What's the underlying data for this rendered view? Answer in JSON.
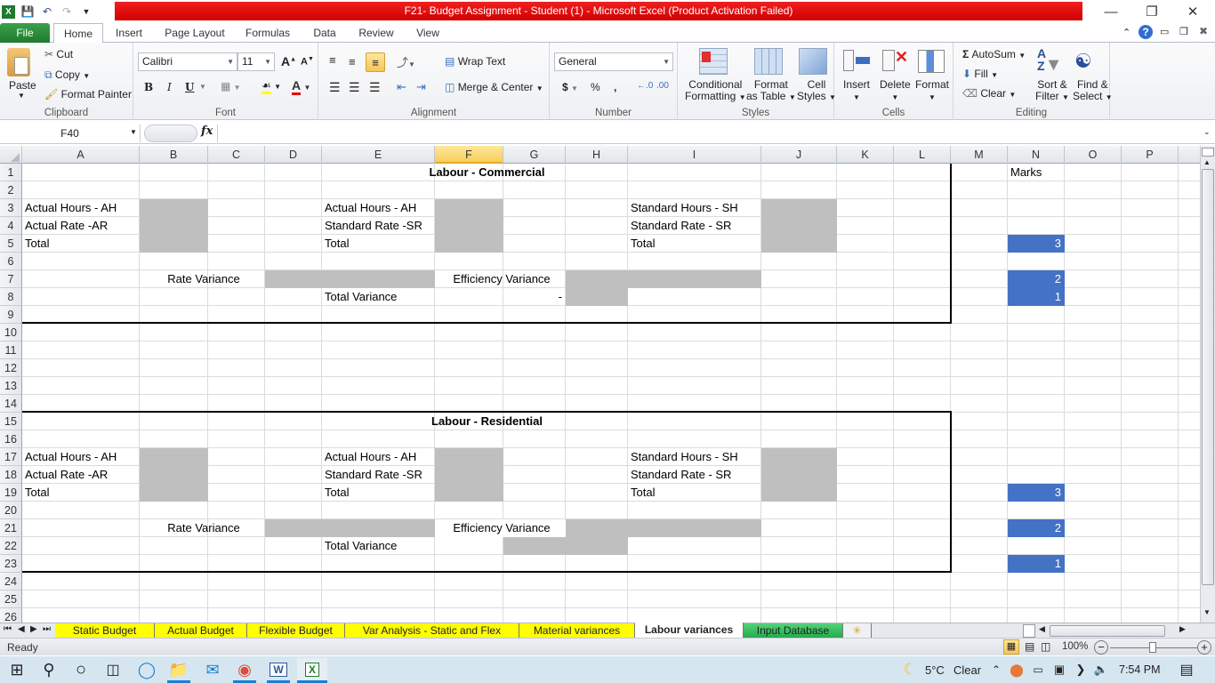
{
  "window": {
    "title": "F21- Budget Assignment - Student (1)  -  Microsoft Excel (Product Activation Failed)",
    "controls": [
      "minimize",
      "restore",
      "close"
    ]
  },
  "ribbon_tabs": [
    "File",
    "Home",
    "Insert",
    "Page Layout",
    "Formulas",
    "Data",
    "Review",
    "View"
  ],
  "ribbon": {
    "clipboard": {
      "label": "Clipboard",
      "paste": "Paste",
      "cut": "Cut",
      "copy": "Copy",
      "format_painter": "Format Painter"
    },
    "font": {
      "label": "Font",
      "font_name": "Calibri",
      "font_size": "11",
      "bold": "B",
      "italic": "I",
      "underline": "U"
    },
    "alignment": {
      "label": "Alignment",
      "wrap_text": "Wrap Text",
      "merge_center": "Merge & Center"
    },
    "number": {
      "label": "Number",
      "format": "General",
      "currency": "$",
      "percent": "%",
      "comma": ","
    },
    "styles": {
      "label": "Styles",
      "conditional_formatting": [
        "Conditional",
        "Formatting"
      ],
      "format_as_table": [
        "Format",
        "as Table"
      ],
      "cell_styles": [
        "Cell",
        "Styles"
      ]
    },
    "cells": {
      "label": "Cells",
      "insert": "Insert",
      "delete": "Delete",
      "format": "Format"
    },
    "editing": {
      "label": "Editing",
      "autosum": "AutoSum",
      "fill": "Fill",
      "clear": "Clear",
      "sort_filter": [
        "Sort &",
        "Filter"
      ],
      "find_select": [
        "Find &",
        "Select"
      ]
    }
  },
  "formula_bar": {
    "name_box": "F40",
    "fx": "fx",
    "formula": ""
  },
  "columns": [
    "A",
    "B",
    "C",
    "D",
    "E",
    "F",
    "G",
    "H",
    "I",
    "J",
    "K",
    "L",
    "M",
    "N",
    "O",
    "P"
  ],
  "selected_column": "F",
  "rows": [
    1,
    2,
    3,
    4,
    5,
    6,
    7,
    8,
    9,
    10,
    11,
    12,
    13,
    14,
    15,
    16,
    17,
    18,
    19,
    20,
    21,
    22,
    23,
    24,
    25,
    26
  ],
  "sheet": {
    "marks_header": "Marks",
    "sections": [
      {
        "title": "Labour  - Commercial",
        "actual_hours": "Actual Hours - AH",
        "actual_rate": "Actual Rate -AR",
        "total": "Total",
        "ah2": "Actual Hours - AH",
        "standard_rate": "Standard Rate -SR",
        "total2": "Total",
        "standard_hours": "Standard Hours - SH",
        "standard_rate2": "Standard Rate - SR",
        "total3": "Total",
        "rate_variance": "Rate Variance",
        "efficiency_variance": "Efficiency Variance",
        "total_variance": "Total Variance",
        "total_variance_value": "-",
        "marks": [
          "3",
          "2",
          "1"
        ]
      },
      {
        "title": "Labour  - Residential",
        "actual_hours": "Actual Hours - AH",
        "actual_rate": "Actual Rate -AR",
        "total": "Total",
        "ah2": "Actual Hours - AH",
        "standard_rate": "Standard Rate -SR",
        "total2": "Total",
        "standard_hours": "Standard Hours - SH",
        "standard_rate2": "Standard Rate - SR",
        "total3": "Total",
        "rate_variance": "Rate Variance",
        "efficiency_variance": "Efficiency Variance",
        "total_variance": "Total Variance",
        "marks": [
          "3",
          "2",
          "1"
        ]
      }
    ]
  },
  "sheet_tabs": [
    {
      "label": "Static Budget",
      "color": "#ffff00"
    },
    {
      "label": "Actual Budget",
      "color": "#ffff00"
    },
    {
      "label": "Flexible Budget",
      "color": "#ffff00"
    },
    {
      "label": "Var Analysis - Static and Flex",
      "color": "#ffff00"
    },
    {
      "label": "Material variances",
      "color": "#ffff00"
    },
    {
      "label": "Labour variances",
      "color": "#ffffff",
      "active": true
    },
    {
      "label": "Input Database",
      "color": "#2ec35a"
    }
  ],
  "status": {
    "mode": "Ready",
    "zoom": "100%"
  },
  "taskbar": {
    "weather_temp": "5°C",
    "weather_text": "Clear",
    "time": "7:54 PM"
  },
  "colors": {
    "title_red": "#e01010",
    "file_green": "#1f7a2e",
    "marks_blue": "#4472c4",
    "input_gray": "#bfbfbf",
    "tab_yellow": "#ffff00"
  }
}
